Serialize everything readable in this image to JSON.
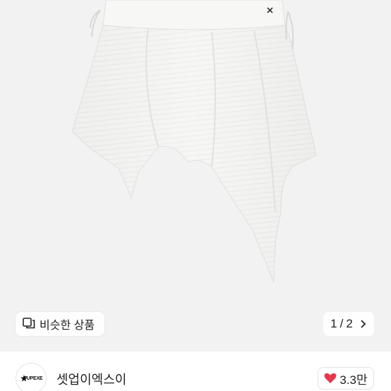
{
  "product_image": {
    "alt": "asymmetric white skirt"
  },
  "similar": {
    "icon": "similar-items-icon",
    "label": "비슷한 상품"
  },
  "pager": {
    "current": "1",
    "separator": "/",
    "total": "2",
    "icon": "chevron-right-icon"
  },
  "shop": {
    "logo_text": "TUPEXE",
    "name": "셋업이엑스이"
  },
  "like": {
    "icon": "heart-icon",
    "count": "3.3만",
    "color": "#e8344e"
  }
}
